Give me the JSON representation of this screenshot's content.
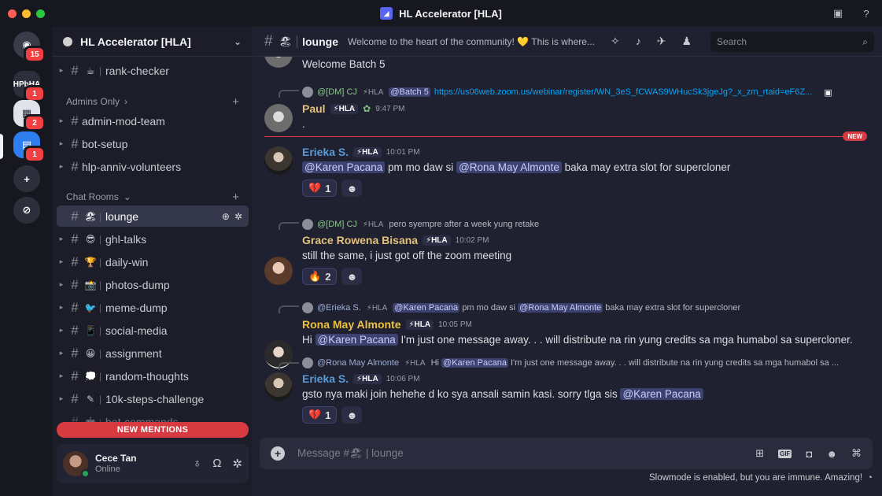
{
  "window": {
    "title": "HL Accelerator [HLA]"
  },
  "rail": {
    "home_badge": "15",
    "servers": [
      {
        "label": "HPbHA",
        "badge": "1"
      },
      {
        "label": "",
        "badge": "2"
      },
      {
        "label": "",
        "badge": "1"
      }
    ]
  },
  "guild": {
    "name": "HL Accelerator [HLA]"
  },
  "channels": {
    "top": [
      {
        "name": "rank-checker",
        "emoji": "☕"
      }
    ],
    "admins_category": "Admins Only",
    "admins": [
      {
        "name": "admin-mod-team"
      },
      {
        "name": "bot-setup"
      },
      {
        "name": "hlp-anniv-volunteers"
      }
    ],
    "chat_category": "Chat Rooms",
    "chat": [
      {
        "name": "lounge",
        "emoji": "🏖"
      },
      {
        "name": "ghl-talks",
        "emoji": "😎"
      },
      {
        "name": "daily-win",
        "emoji": "🏆"
      },
      {
        "name": "photos-dump",
        "emoji": "📸"
      },
      {
        "name": "meme-dump",
        "emoji": "🐦"
      },
      {
        "name": "social-media",
        "emoji": "📱"
      },
      {
        "name": "assignment",
        "emoji": "😀"
      },
      {
        "name": "random-thoughts",
        "emoji": "💭"
      },
      {
        "name": "10k-steps-challenge",
        "emoji": "✎"
      },
      {
        "name": "bot-commands",
        "emoji": "🤖"
      }
    ],
    "new_mentions": "NEW MENTIONS"
  },
  "user": {
    "name": "Cece Tan",
    "status": "Online"
  },
  "channel_header": {
    "name": "lounge",
    "emoji": "🏖",
    "topic": "Welcome to the heart of the community! 💛 This is where...",
    "search_placeholder": "Search"
  },
  "messages": {
    "m0": {
      "body": "Welcome Batch 5"
    },
    "m1": {
      "reply_name": "@[DM] CJ",
      "reply_tag": "⚡HLA",
      "reply_mention": "@Batch 5",
      "reply_link": "https://us06web.zoom.us/webinar/register/WN_3eS_fCWAS9WHucSk3jgeJg?_x_zm_rtaid=eF6Z...",
      "author": "Paul",
      "tag": "⚡HLA",
      "time": "9:47 PM",
      "body": "."
    },
    "new_badge": "NEW",
    "m2": {
      "author": "Erieka S.",
      "tag": "⚡HLA",
      "time": "10:01 PM",
      "mention1": "@Karen Pacana",
      "text1": " pm mo daw si ",
      "mention2": "@Rona May Almonte",
      "text2": " baka may extra slot for supercloner",
      "reaction": "💔",
      "reaction_count": "1"
    },
    "m3": {
      "reply_name": "@[DM] CJ",
      "reply_tag": "⚡HLA",
      "reply_text": "pero syempre after a week yung retake",
      "author": "Grace Rowena Bisana",
      "tag": "⚡HLA",
      "time": "10:02 PM",
      "body": "still the same, i just got off the zoom meeting",
      "reaction": "🔥",
      "reaction_count": "2"
    },
    "m4": {
      "reply_name": "@Erieka S.",
      "reply_tag": "⚡HLA",
      "reply_mention1": "@Karen Pacana",
      "reply_text1": " pm mo daw si ",
      "reply_mention2": "@Rona May Almonte",
      "reply_text2": " baka may extra slot for supercloner",
      "author": "Rona May Almonte",
      "tag": "⚡HLA",
      "time": "10:05 PM",
      "text0": "Hi ",
      "mention": "@Karen Pacana",
      "text1": " I'm just one message away. . .  will distribute na rin yung credits sa mga humabol sa supercloner."
    },
    "m5": {
      "reply_name": "@Rona May Almonte",
      "reply_tag": "⚡HLA",
      "reply_text0": "Hi ",
      "reply_mention": "@Karen Pacana",
      "reply_text1": " I'm just one message away. . .  will distribute na rin yung credits sa mga humabol sa ...",
      "author": "Erieka S.",
      "tag": "⚡HLA",
      "time": "10:06 PM",
      "text0": "gsto nya maki join hehehe d ko sya ansali samin kasi. sorry tlga sis ",
      "mention": "@Karen Pacana",
      "reaction": "💔",
      "reaction_count": "1"
    }
  },
  "composer": {
    "placeholder": "Message #🏖 | lounge"
  },
  "slowmode": "Slowmode is enabled, but you are immune. Amazing!",
  "colors": {
    "erieka": "#5b9bd5",
    "grace": "#e3c27a",
    "rona": "#f0c23b",
    "paul": "#e3c27a",
    "accent": "#5865f2",
    "danger": "#d83a42"
  }
}
